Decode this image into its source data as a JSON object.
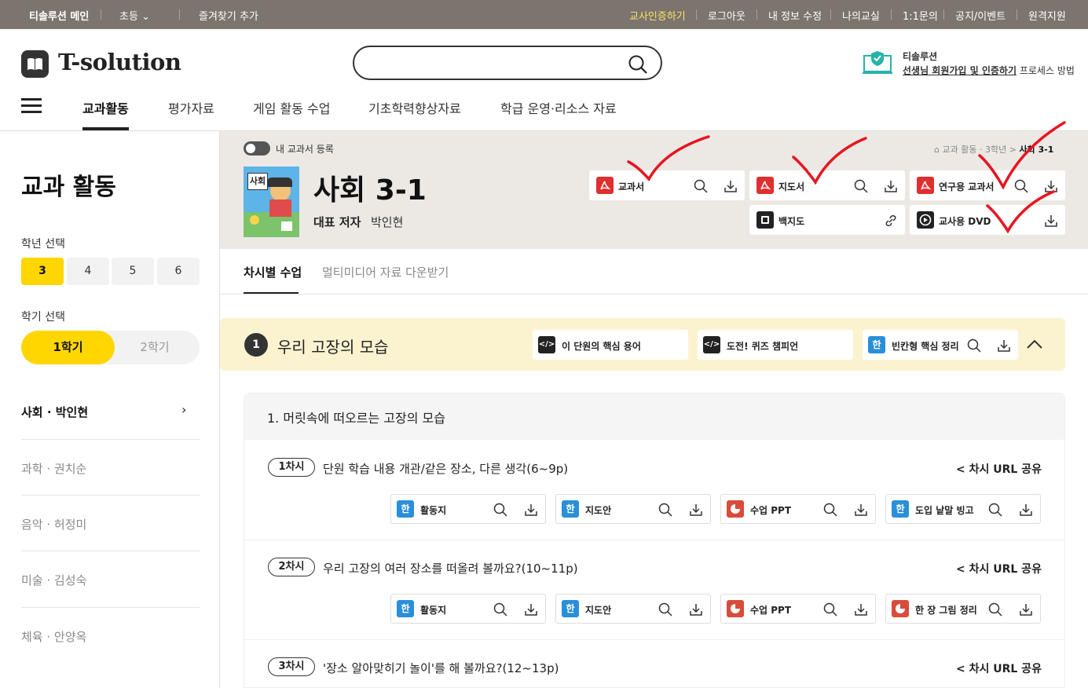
{
  "topbar": {
    "main": "티솔루션 메인",
    "level": "초등",
    "favorite": "즐겨찾기 추가",
    "links": [
      "교사인증하기",
      "로그아웃",
      "내 정보 수정",
      "나의교실",
      "1:1문의",
      "공지/이벤트",
      "원격지원"
    ]
  },
  "header": {
    "logo": "T-solution",
    "search_placeholder": "",
    "cert_title": "티솔루션",
    "cert_link": "선생님 회원가입 및 인증하기",
    "cert_suffix": "프로세스 방법"
  },
  "nav": [
    "교과활동",
    "평가자료",
    "게임 활동 수업",
    "기초학력향상자료",
    "학급 운영·리소스 자료"
  ],
  "sidebar": {
    "title": "교과 활동",
    "grade_label": "학년 선택",
    "grades": [
      "3",
      "4",
      "5",
      "6"
    ],
    "semester_label": "학기 선택",
    "semesters": [
      "1학기",
      "2학기"
    ],
    "subjects": [
      "사회 · 박인현",
      "과학 · 권치순",
      "음악 · 허정미",
      "미술 · 김성숙",
      "체육 · 안양옥"
    ]
  },
  "book": {
    "toggle_label": "내 교과서 등록",
    "cover_label": "사회",
    "title": "사회 3-1",
    "author_label": "대표 저자",
    "author": "박인현",
    "breadcrumb": [
      "교과 활동",
      "3학년",
      "사회 3-1"
    ],
    "resources": [
      "교과서",
      "지도서",
      "연구용 교과서",
      "백지도",
      "교사용 DVD"
    ]
  },
  "tabs": [
    "차시별 수업",
    "멀티미디어 자료 다운받기"
  ],
  "unit": {
    "number": "1",
    "title": "우리 고장의 모습",
    "resources": [
      "이 단원의 핵심 용어",
      "도전! 퀴즈 챔피언",
      "빈칸형 핵심 정리"
    ]
  },
  "section_title": "1. 머릿속에 떠오르는 고장의 모습",
  "share_label": "차시 URL 공유",
  "lessons": [
    {
      "num": "1차시",
      "title": "단원 학습 내용 개관/같은 장소, 다른 생각(6~9p)",
      "materials": [
        "활동지",
        "지도안",
        "수업 PPT",
        "도입 낱말 빙고"
      ]
    },
    {
      "num": "2차시",
      "title": "우리 고장의 여러 장소를 떠올려 볼까요?(10~11p)",
      "materials": [
        "활동지",
        "지도안",
        "수업 PPT",
        "한 장 그림 정리"
      ]
    },
    {
      "num": "3차시",
      "title": "'장소 알아맞히기 놀이'를 해 볼까요?(12~13p)",
      "materials": []
    }
  ],
  "icons": {
    "hwp": "한",
    "code": "</>"
  },
  "colors": {
    "accent": "#ffd600",
    "topbar": "#7b756e",
    "hwp_blue": "#2a8fd8",
    "ppt_red": "#d94b3b",
    "pdf_red": "#e02f2f",
    "annotation": "#e8141f"
  }
}
